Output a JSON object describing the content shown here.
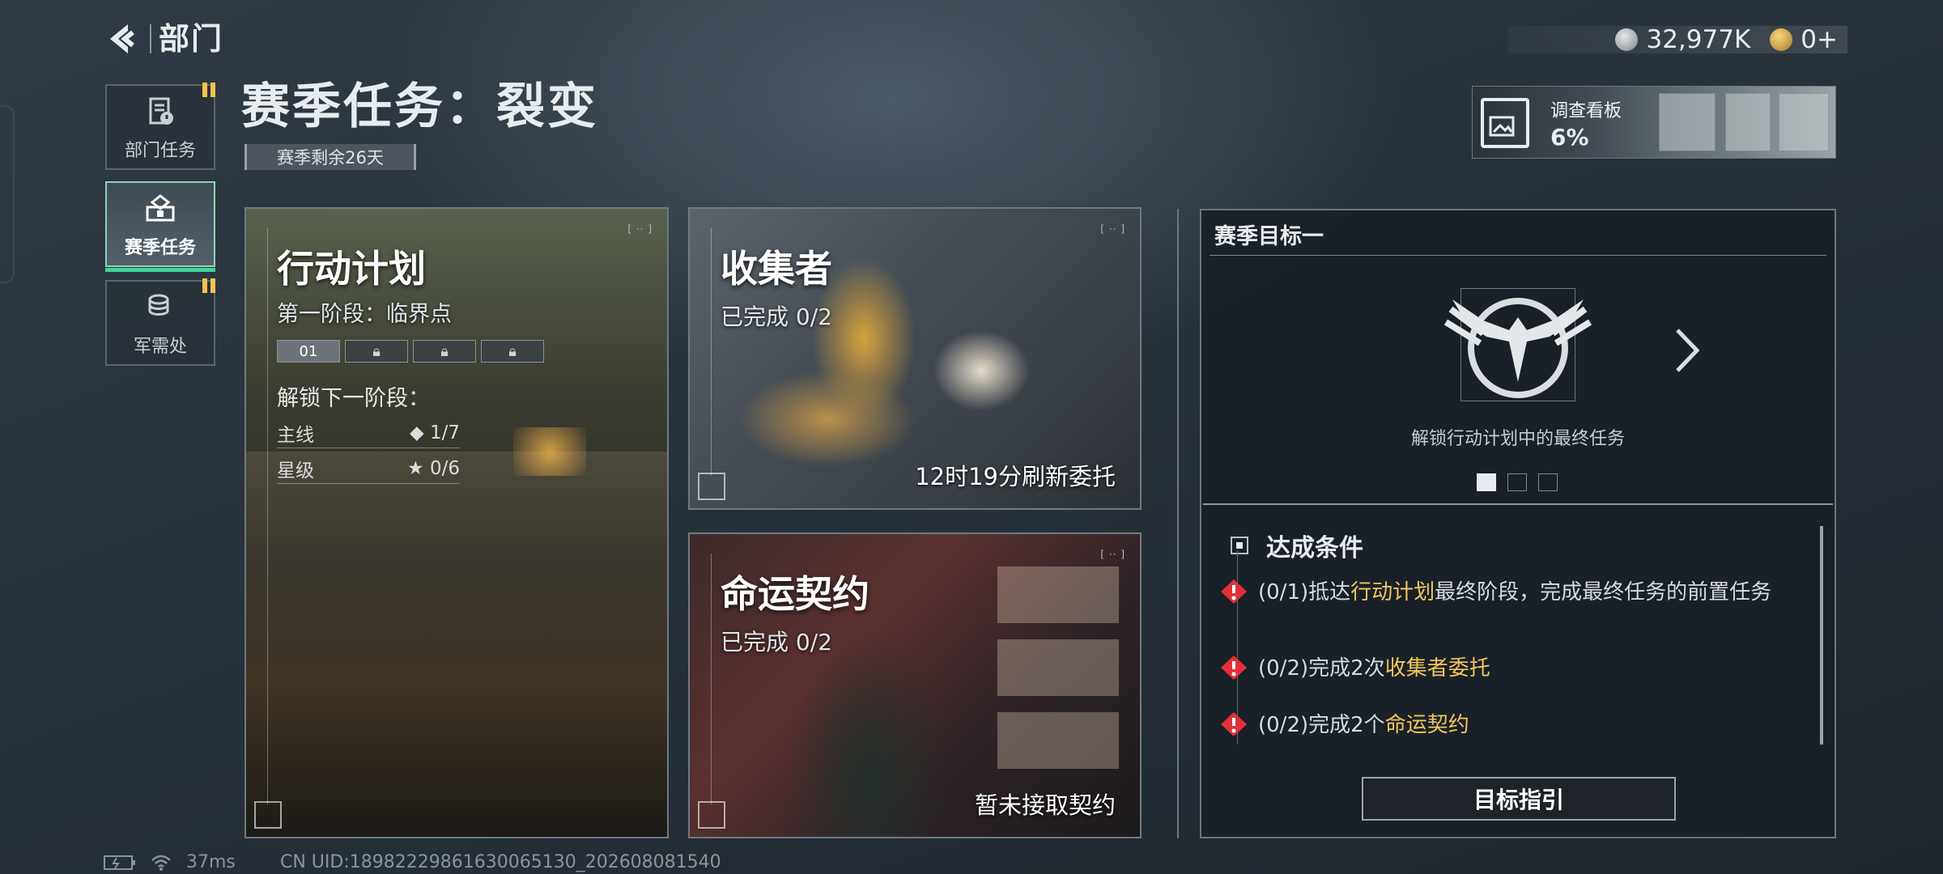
{
  "header": {
    "title": "部门"
  },
  "currency": {
    "silver": "32,977K",
    "gold": "0+"
  },
  "survey_board": {
    "label": "调查看板",
    "percent": "6%"
  },
  "sidebar": {
    "items": [
      {
        "label": "部门任务",
        "icon": "document-icon",
        "badge": true
      },
      {
        "label": "赛季任务",
        "icon": "season-crate-icon",
        "active": true
      },
      {
        "label": "军需处",
        "icon": "coins-icon",
        "badge": true
      }
    ]
  },
  "season": {
    "title": "赛季任务：裂变",
    "remaining": "赛季剩余26天"
  },
  "cards": {
    "action_plan": {
      "title": "行动计划",
      "stage": "第一阶段：临界点",
      "stages": [
        "01",
        "",
        "",
        ""
      ],
      "unlock_label": "解锁下一阶段：",
      "requirements": [
        {
          "label": "主线",
          "symbol": "◆",
          "value": "1/7"
        },
        {
          "label": "星级",
          "symbol": "★",
          "value": "0/6"
        }
      ]
    },
    "collector": {
      "title": "收集者",
      "progress": "已完成 0/2",
      "note": "12时19分刷新委托"
    },
    "fate": {
      "title": "命运契约",
      "progress": "已完成 0/2",
      "note": "暂未接取契约"
    }
  },
  "goal_panel": {
    "title": "赛季目标一",
    "emblem": "eagle-emblem-icon",
    "caption": "解锁行动计划中的最终任务",
    "page_dots": 3,
    "conditions_title": "达成条件",
    "conditions": [
      {
        "prefix": "(0/1)抵达",
        "highlight": "行动计划",
        "suffix": "最终阶段，完成最终任务的前置任务"
      },
      {
        "prefix": "(0/2)完成2次",
        "highlight": "收集者委托",
        "suffix": ""
      },
      {
        "prefix": "(0/2)完成2个",
        "highlight": "命运契约",
        "suffix": ""
      }
    ],
    "guide_button": "目标指引"
  },
  "status": {
    "ping": "37ms",
    "uid": "CN UID:18982229861630065130_202608081540"
  },
  "colors": {
    "accent": "#3fd49a",
    "highlight": "#f0c75c",
    "warning": "#e0313a",
    "badge": "#f0c34a"
  }
}
